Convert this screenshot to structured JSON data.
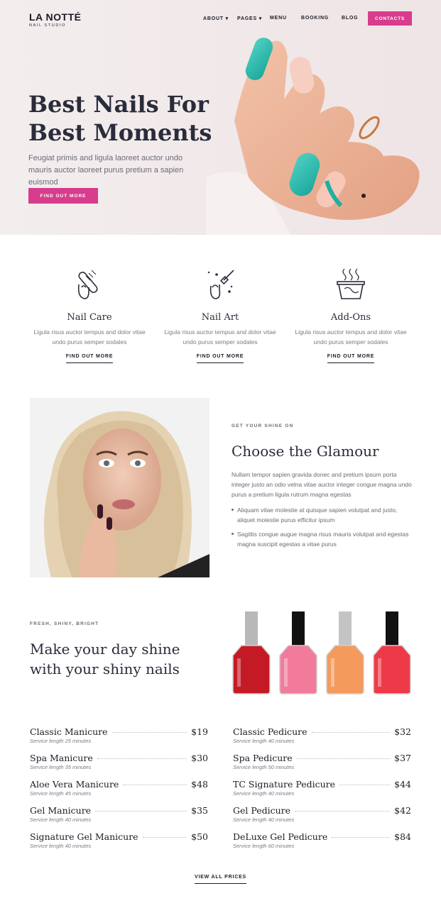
{
  "header": {
    "brand": "LA NOTTÉ",
    "brand_sub": "NAIL STUDIO",
    "nav": [
      "ABOUT ▾",
      "PAGES ▾",
      "MENU",
      "BOOKING",
      "BLOG"
    ],
    "contacts": "CONTACTS"
  },
  "hero": {
    "title_line1": "Best Nails For",
    "title_line2": "Best Moments",
    "text": "Feugiat primis and ligula laoreet auctor undo mauris auctor laoreet purus pretium a sapien euismod",
    "button": "FIND OUT MORE"
  },
  "features": [
    {
      "icon": "nail-file-icon",
      "title": "Nail Care",
      "desc": "Ligula risus auctor tempus and dolor vitae undo purus semper sodales",
      "link": "FIND OUT MORE"
    },
    {
      "icon": "nail-polish-brush-icon",
      "title": "Nail Art",
      "desc": "Ligula risus auctor tempus and dolor vitae undo purus semper sodales",
      "link": "FIND OUT MORE"
    },
    {
      "icon": "spa-bowl-icon",
      "title": "Add-Ons",
      "desc": "Ligula risus auctor tempus and dolor vitae undo purus semper sodales",
      "link": "FIND OUT MORE"
    }
  ],
  "glamour": {
    "eyebrow": "GET YOUR SHINE ON",
    "title": "Choose the Glamour",
    "text": "Nullam tempor sapien gravida donec and pretium ipsum porta integer justo an odio velna vitae auctor integer congue magna undo purus a pretium ligula rutrum magna egestas",
    "bullets": [
      "Aliquam vitae molestie at quisque sapien volutpat and justo, aliquet molestie purus efficitur ipsum",
      "Sagittis congue augue magna risus mauris volutpat and egestas magna suscipit egestas a vitae purus"
    ]
  },
  "shine": {
    "eyebrow": "FRESH, SHINY, BRIGHT",
    "title_line1": "Make your day shine",
    "title_line2": "with your shiny nails",
    "bottle_colors": [
      "#c41a26",
      "#f27a9a",
      "#f49a5c",
      "#ee3a48"
    ]
  },
  "prices": {
    "left": [
      {
        "name": "Classic Manicure",
        "price": "$19",
        "duration": "Service length 25 minutes"
      },
      {
        "name": "Spa Manicure",
        "price": "$30",
        "duration": "Service length 35 minutes"
      },
      {
        "name": "Aloe Vera Manicure",
        "price": "$48",
        "duration": "Service length 45 minutes"
      },
      {
        "name": "Gel Manicure",
        "price": "$35",
        "duration": "Service length 40 minutes"
      },
      {
        "name": "Signature Gel Manicure",
        "price": "$50",
        "duration": "Service length 40 minutes"
      }
    ],
    "right": [
      {
        "name": "Classic Pedicure",
        "price": "$32",
        "duration": "Service length 40 minutes"
      },
      {
        "name": "Spa Pedicure",
        "price": "$37",
        "duration": "Service length 50 minutes"
      },
      {
        "name": "TC Signature Pedicure",
        "price": "$44",
        "duration": "Service length 40 minutes"
      },
      {
        "name": "Gel Pedicure",
        "price": "$42",
        "duration": "Service length 40 minutes"
      },
      {
        "name": "DeLuxe Gel Pedicure",
        "price": "$84",
        "duration": "Service length 60 minutes"
      }
    ],
    "view_all": "VIEW ALL PRICES"
  },
  "colors": {
    "accent": "#d83c8c",
    "text": "#2a2c3a",
    "muted": "#6a6b76"
  }
}
